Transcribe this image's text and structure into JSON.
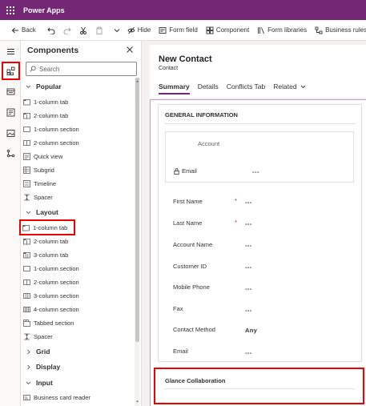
{
  "app": {
    "title": "Power Apps"
  },
  "command_bar": {
    "back": "Back",
    "hide": "Hide",
    "form_field": "Form field",
    "component": "Component",
    "form_libraries": "Form libraries",
    "business_rules": "Business rules"
  },
  "components_panel": {
    "title": "Components",
    "search_placeholder": "Search",
    "sections": {
      "popular": {
        "label": "Popular",
        "items": [
          "1-column tab",
          "2-column tab",
          "1-column section",
          "2-column section",
          "Quick view",
          "Subgrid",
          "Timeline",
          "Spacer"
        ]
      },
      "layout": {
        "label": "Layout",
        "items": [
          "1-column tab",
          "2-column tab",
          "3-column tab",
          "1-column section",
          "2-column section",
          "3-column section",
          "4-column section",
          "Tabbed section",
          "Spacer"
        ]
      },
      "grid": {
        "label": "Grid"
      },
      "display": {
        "label": "Display"
      },
      "input": {
        "label": "Input",
        "items": [
          "Business card reader"
        ]
      }
    }
  },
  "form": {
    "title": "New Contact",
    "entity": "Contact",
    "tabs": [
      "Summary",
      "Details",
      "Conflicts Tab",
      "Related"
    ],
    "general_section": {
      "title": "GENERAL INFORMATION",
      "quick_view": {
        "label": "Account",
        "email_label": "Email",
        "email_value": "---"
      },
      "fields": [
        {
          "label": "First Name",
          "required": "*",
          "value": "---"
        },
        {
          "label": "Last Name",
          "required": "*",
          "value": "---"
        },
        {
          "label": "Account Name",
          "required": "",
          "value": "---"
        },
        {
          "label": "Customer ID",
          "required": "",
          "value": "---"
        },
        {
          "label": "Mobile Phone",
          "required": "",
          "value": "---"
        },
        {
          "label": "Fax",
          "required": "",
          "value": "---"
        },
        {
          "label": "Contact Method",
          "required": "",
          "value": "Any"
        },
        {
          "label": "Email",
          "required": "",
          "value": "---"
        }
      ]
    },
    "glance_section": {
      "title": "Glance Collaboration"
    }
  },
  "colors": {
    "brand": "#742774",
    "highlight": "#ee0000"
  }
}
